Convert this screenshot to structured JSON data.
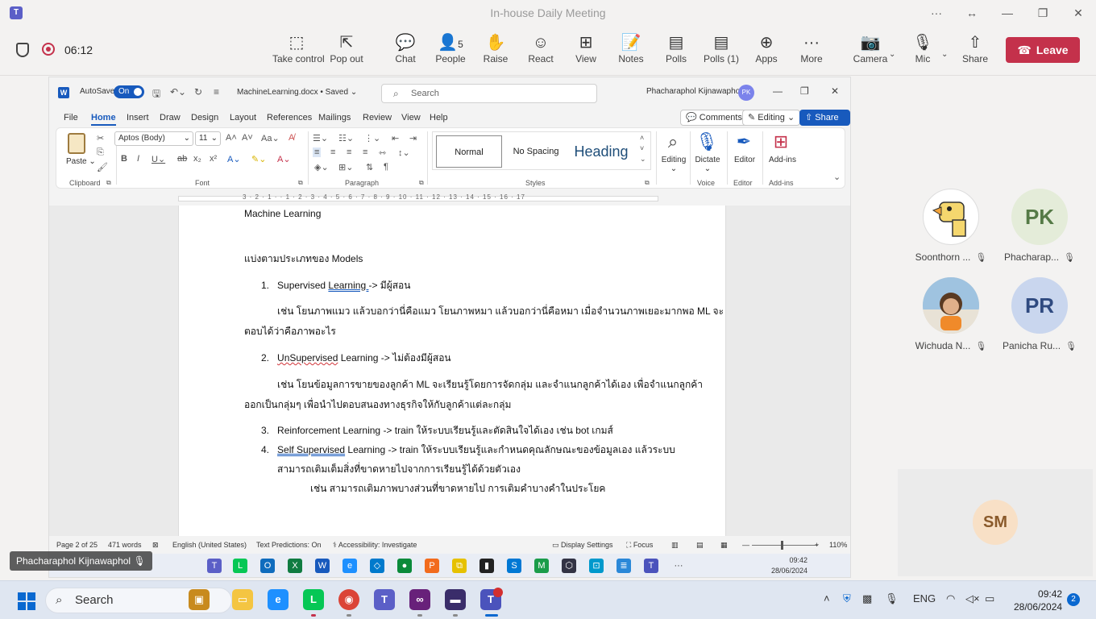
{
  "teams": {
    "title": "In-house Daily Meeting",
    "timer": "06:12",
    "toolbar": [
      {
        "name": "take-control",
        "label": "Take control",
        "icon": "⬚"
      },
      {
        "name": "pop-out",
        "label": "Pop out",
        "icon": "⇱"
      },
      {
        "name": "chat",
        "label": "Chat",
        "icon": "💬"
      },
      {
        "name": "people",
        "label": "People",
        "icon": "👤",
        "count": "5"
      },
      {
        "name": "raise",
        "label": "Raise",
        "icon": "✋"
      },
      {
        "name": "react",
        "label": "React",
        "icon": "☺"
      },
      {
        "name": "view",
        "label": "View",
        "icon": "⊞"
      },
      {
        "name": "notes",
        "label": "Notes",
        "icon": "📝"
      },
      {
        "name": "polls",
        "label": "Polls",
        "icon": "▤"
      },
      {
        "name": "polls-1",
        "label": "Polls (1)",
        "icon": "▤"
      },
      {
        "name": "apps",
        "label": "Apps",
        "icon": "⊕"
      },
      {
        "name": "more",
        "label": "More",
        "icon": "···"
      },
      {
        "name": "camera",
        "label": "Camera",
        "icon": "📷"
      },
      {
        "name": "mic",
        "label": "Mic",
        "icon": "🎙"
      },
      {
        "name": "share",
        "label": "Share",
        "icon": "⇧"
      }
    ],
    "leave_label": "Leave",
    "presenter": "Phacharaphol Kijnawaphol",
    "participants": [
      {
        "name": "Soonthorn ...",
        "initials": "",
        "bg": "#ffffff",
        "fg": "#000000"
      },
      {
        "name": "Phacharap...",
        "initials": "PK",
        "bg": "#e4ecd9",
        "fg": "#557a46"
      },
      {
        "name": "Wichuda N...",
        "initials": "",
        "bg": "#d9cfc2",
        "fg": "#000000"
      },
      {
        "name": "Panicha Ru...",
        "initials": "PR",
        "bg": "#c9d6ee",
        "fg": "#2f4a80"
      }
    ],
    "sm_initials": "SM"
  },
  "word": {
    "autosave": "AutoSave",
    "toggle": "On",
    "docname": "MachineLearning.docx • Saved",
    "search_placeholder": "Search",
    "user": "Phacharaphol Kijnawaphol",
    "user_initials": "PK",
    "tabs": [
      "File",
      "Home",
      "Insert",
      "Draw",
      "Design",
      "Layout",
      "References",
      "Mailings",
      "Review",
      "View",
      "Help"
    ],
    "comments": "Comments",
    "editing": "Editing",
    "share": "Share",
    "ribbon": {
      "paste": "Paste",
      "font": "Aptos (Body)",
      "size": "11",
      "styles": [
        "Normal",
        "No Spacing",
        "Heading"
      ],
      "editing": "Editing",
      "dictate": "Dictate",
      "editor": "Editor",
      "addins": "Add-ins",
      "groups": [
        "Clipboard",
        "Font",
        "Paragraph",
        "Styles",
        "Voice",
        "Editor",
        "Add-ins"
      ]
    },
    "ruler": "3 · 2 · 1 ·   · 1 · 2 · 3 · 4 · 5 · 6 · 7 · 8 · 9 · 10 · 11 · 12 · 13 · 14 · 15 · 16 · 17",
    "doc": {
      "title": "Machine Learning",
      "subtitle": "แบ่งตามประเภทของ Models",
      "l1_num": "1.",
      "l1_a": "Supervised ",
      "l1_b": "Learning ",
      "l1_c": " -> มีผู้สอน",
      "p1a": "เช่น โยนภาพแมว แล้วบอกว่านี่คือแมว โยนภาพหมา แล้วบอกว่านี่คือหมา เมื่อจำนวนภาพเยอะมากพอ ML จะ",
      "p1b": "ตอบได้ว่าคือภาพอะไร",
      "l2_num": "2.",
      "l2_a": "UnSupervised",
      "l2_b": " Learning -> ไม่ต้องมีผู้สอน",
      "p2a": "เช่น โยนข้อมูลการขายของลูกค้า ML จะเรียนรู้โดยการจัดกลุ่ม และจำแนกลูกค้าได้เอง เพื่อจำแนกลูกค้า",
      "p2b": "ออกเป็นกลุ่มๆ เพื่อนำไปตอบสนองทางธุรกิจให้กับลูกค้าแต่ละกลุ่ม",
      "l3_num": "3.",
      "l3": "Reinforcement Learning -> train ให้ระบบเรียนรู้และตัดสินใจได้เอง เช่น bot เกมส์",
      "l4_num": "4.",
      "l4_a": "Self Supervised",
      "l4_b": " Learning -> train ให้ระบบเรียนรู้และกำหนดคุณลักษณะของข้อมูลเอง แล้วระบบ",
      "l4_c": "สามารถเติมเต็มสิ่งที่ขาดหายไปจากการเรียนรู้ได้ด้วยตัวเอง",
      "p4": "เช่น สามารถเติมภาพบางส่วนที่ขาดหายไป การเติมคำบางคำในประโยค"
    },
    "status": {
      "page": "Page 2 of 25",
      "words": "471 words",
      "lang": "English (United States)",
      "predictions": "Text Predictions: On",
      "accessibility": "Accessibility: Investigate",
      "display": "Display Settings",
      "focus": "Focus",
      "zoom": "110%"
    },
    "inner_time": "09:42",
    "inner_date": "28/06/2024"
  },
  "taskbar": {
    "search": "Search",
    "lang": "ENG",
    "time": "09:42",
    "date": "28/06/2024",
    "notifications": "2"
  },
  "colors": {
    "accent": "#5b5fc7",
    "leave": "#c4314b",
    "word_blue": "#185abd"
  }
}
